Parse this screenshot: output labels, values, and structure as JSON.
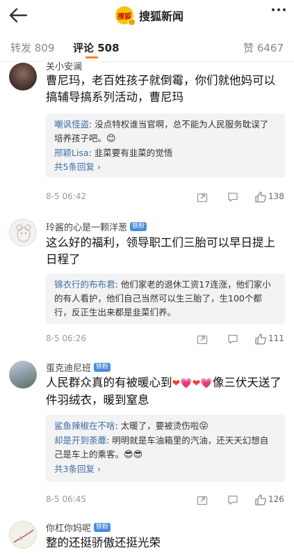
{
  "header": {
    "logo_text": "搜狐",
    "app_name": "搜狐新闻"
  },
  "tabs": {
    "repost": "转发 809",
    "comment": "评论 508",
    "like": "赞 6467"
  },
  "comments": [
    {
      "username": "关小安澜",
      "text": "曹尼玛，老百姓孩子就倒霉，你们就他妈可以搞辅导搞系列活动，曹尼玛",
      "replies": [
        {
          "name": "嘲讽怪盗",
          "text": ": 没点特权谁当官啊，总不能为人民服务耽误了培养孩子吧。"
        },
        {
          "name": "邢颖Lisa",
          "text": ": 韭菜要有韭菜的觉悟"
        }
      ],
      "reply_count": "共5条回复 ›",
      "time": "8-5 06:42",
      "likes": "138"
    },
    {
      "username": "玲酱的心是一颗洋葱",
      "badge": "铁粉",
      "text": "这么好的福利，领导职工们三胎可以早日提上日程了",
      "replies": [
        {
          "name": "锦衣行的布布君",
          "text": ": 他们家老的退休工资17连涨，他们家小的有人看护，他们自己当然可以生三胎了，生100个都行，反正生出来都是韭菜们养。"
        }
      ],
      "time": "8-5 06:26",
      "likes": "111"
    },
    {
      "username": "蛋克迪尼班",
      "badge": "铁粉",
      "text_1": "人民群众真的有被暖心到",
      "text_2": "像三伏天送了件羽绒衣，暖到窒息",
      "replies": [
        {
          "name": "鲨鱼辣椒在不啥",
          "text": ": 太暖了，要被烫伤啦"
        },
        {
          "name": "却是开到荼蘼",
          "text": ": 明明就是车油箱里的汽油，还天天幻想自己是车上的乘客。"
        }
      ],
      "reply_count": "共3条回复 ›",
      "time": "8-5 06:45",
      "likes": "126"
    },
    {
      "username": "你杠你妈呢",
      "badge": "铁粉",
      "text": "整的还挺骄傲还挺光荣"
    }
  ]
}
